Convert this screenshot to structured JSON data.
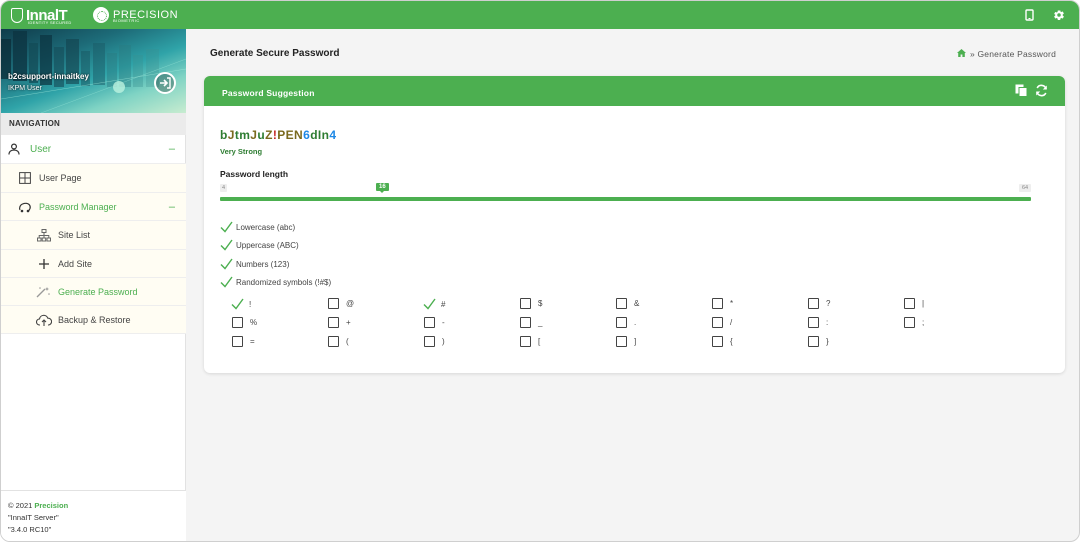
{
  "topbar": {
    "logo_text": "InnalT",
    "logo_tagline": "IDENTITY SECURED",
    "precision_text": "PRECISION",
    "precision_sub": "BIOMETRIC",
    "icons": [
      "mobile-icon",
      "gear-icon"
    ]
  },
  "sidebar": {
    "user_name": "b2csupport-innaitkey",
    "user_role": "IKPM User",
    "nav_title": "NAVIGATION",
    "items": [
      {
        "label": "User",
        "icon": "user-icon",
        "collapse": "–"
      },
      {
        "label": "User Page",
        "icon": "grid-icon"
      },
      {
        "label": "Password Manager",
        "icon": "key-icon",
        "collapse": "–"
      },
      {
        "label": "Site List",
        "icon": "sitemap-icon"
      },
      {
        "label": "Add Site",
        "icon": "plus-icon"
      },
      {
        "label": "Generate Password",
        "icon": "magic-wand-icon"
      },
      {
        "label": "Backup & Restore",
        "icon": "cloud-upload-icon"
      }
    ],
    "footer": {
      "copyright": "© 2021",
      "company": "Precision",
      "server": "\"InnaIT Server\"",
      "version": "\"3.4.0 RC10\""
    }
  },
  "header": {
    "page_title": "Generate Secure Password",
    "breadcrumb": "» Generate Password"
  },
  "card": {
    "title": "Password Suggestion",
    "actions": [
      "copy-icon",
      "refresh-icon"
    ],
    "password_parts": [
      {
        "t": "b",
        "k": "lo"
      },
      {
        "t": "J",
        "k": "up"
      },
      {
        "t": "tm",
        "k": "lo"
      },
      {
        "t": "J",
        "k": "up"
      },
      {
        "t": "u",
        "k": "lo"
      },
      {
        "t": "Z",
        "k": "up"
      },
      {
        "t": "!",
        "k": "sy"
      },
      {
        "t": "PEN",
        "k": "up"
      },
      {
        "t": "6",
        "k": "nm"
      },
      {
        "t": "dIn",
        "k": "lo"
      },
      {
        "t": "4",
        "k": "nm"
      }
    ],
    "strength": "Very Strong",
    "length_label": "Password length",
    "length": {
      "min": "4",
      "max": "64",
      "value": "16"
    },
    "options": [
      {
        "label": "Lowercase (abc)",
        "checked": true
      },
      {
        "label": "Uppercase (ABC)",
        "checked": true
      },
      {
        "label": "Numbers (123)",
        "checked": true
      },
      {
        "label": "Randomized symbols (!#$)",
        "checked": true
      }
    ],
    "symbols": [
      [
        {
          "s": "!",
          "c": true
        },
        {
          "s": "@",
          "c": false
        },
        {
          "s": "#",
          "c": true
        },
        {
          "s": "$",
          "c": false
        },
        {
          "s": "&",
          "c": false
        },
        {
          "s": "*",
          "c": false
        },
        {
          "s": "?",
          "c": false
        },
        {
          "s": "|",
          "c": false
        }
      ],
      [
        {
          "s": "%",
          "c": false
        },
        {
          "s": "+",
          "c": false
        },
        {
          "s": "-",
          "c": false
        },
        {
          "s": "_",
          "c": false
        },
        {
          "s": ".",
          "c": false
        },
        {
          "s": "/",
          "c": false
        },
        {
          "s": ":",
          "c": false
        },
        {
          "s": ";",
          "c": false
        }
      ],
      [
        {
          "s": "=",
          "c": false
        },
        {
          "s": "(",
          "c": false
        },
        {
          "s": ")",
          "c": false
        },
        {
          "s": "[",
          "c": false
        },
        {
          "s": "]",
          "c": false
        },
        {
          "s": "{",
          "c": false
        },
        {
          "s": "}",
          "c": false
        }
      ]
    ]
  },
  "colors": {
    "accent": "#4caf50",
    "header_bg": "#4caf50"
  }
}
